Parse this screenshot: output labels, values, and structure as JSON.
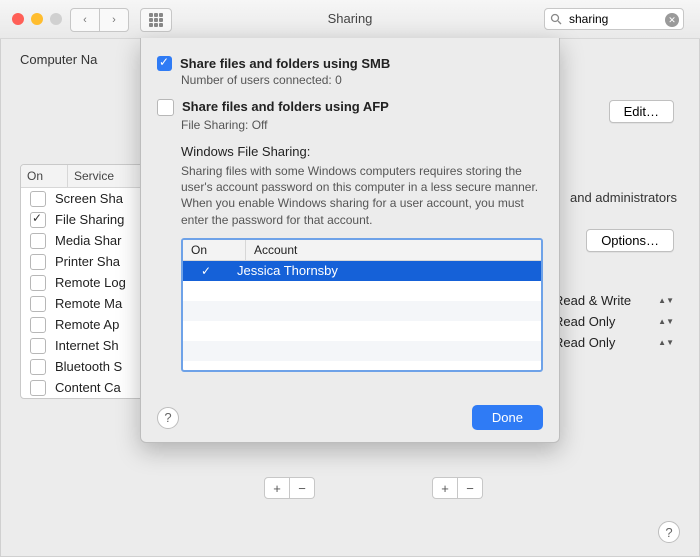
{
  "titlebar": {
    "title": "Sharing",
    "search_value": "sharing"
  },
  "background": {
    "computer_name_label": "Computer Na",
    "edit_label": "Edit…",
    "options_label": "Options…",
    "admins_text": "and administrators",
    "services_header": {
      "on": "On",
      "service": "Service"
    },
    "services": [
      {
        "on": false,
        "label": "Screen Sha"
      },
      {
        "on": true,
        "label": "File Sharing"
      },
      {
        "on": false,
        "label": "Media Shar"
      },
      {
        "on": false,
        "label": "Printer Sha"
      },
      {
        "on": false,
        "label": "Remote Log"
      },
      {
        "on": false,
        "label": "Remote Ma"
      },
      {
        "on": false,
        "label": "Remote Ap"
      },
      {
        "on": false,
        "label": "Internet Sh"
      },
      {
        "on": false,
        "label": "Bluetooth S"
      },
      {
        "on": false,
        "label": "Content Ca"
      }
    ],
    "perms": [
      {
        "label": "Read & Write"
      },
      {
        "label": "Read Only"
      },
      {
        "label": "Read Only"
      }
    ]
  },
  "sheet": {
    "smb_label": "Share files and folders using SMB",
    "smb_sub": "Number of users connected: 0",
    "afp_label": "Share files and folders using AFP",
    "afp_sub": "File Sharing: Off",
    "wfs_heading": "Windows File Sharing:",
    "wfs_desc": "Sharing files with some Windows computers requires storing the user's account password on this computer in a less secure manner. When you enable Windows sharing for a user account, you must enter the password for that account.",
    "acct_header": {
      "on": "On",
      "account": "Account"
    },
    "accounts": [
      {
        "on": true,
        "name": "Jessica Thornsby",
        "selected": true
      }
    ],
    "done_label": "Done"
  },
  "glyphs": {
    "plus": "+",
    "minus": "−",
    "help": "?",
    "clear": "✕",
    "chev_l": "‹",
    "chev_r": "›"
  }
}
